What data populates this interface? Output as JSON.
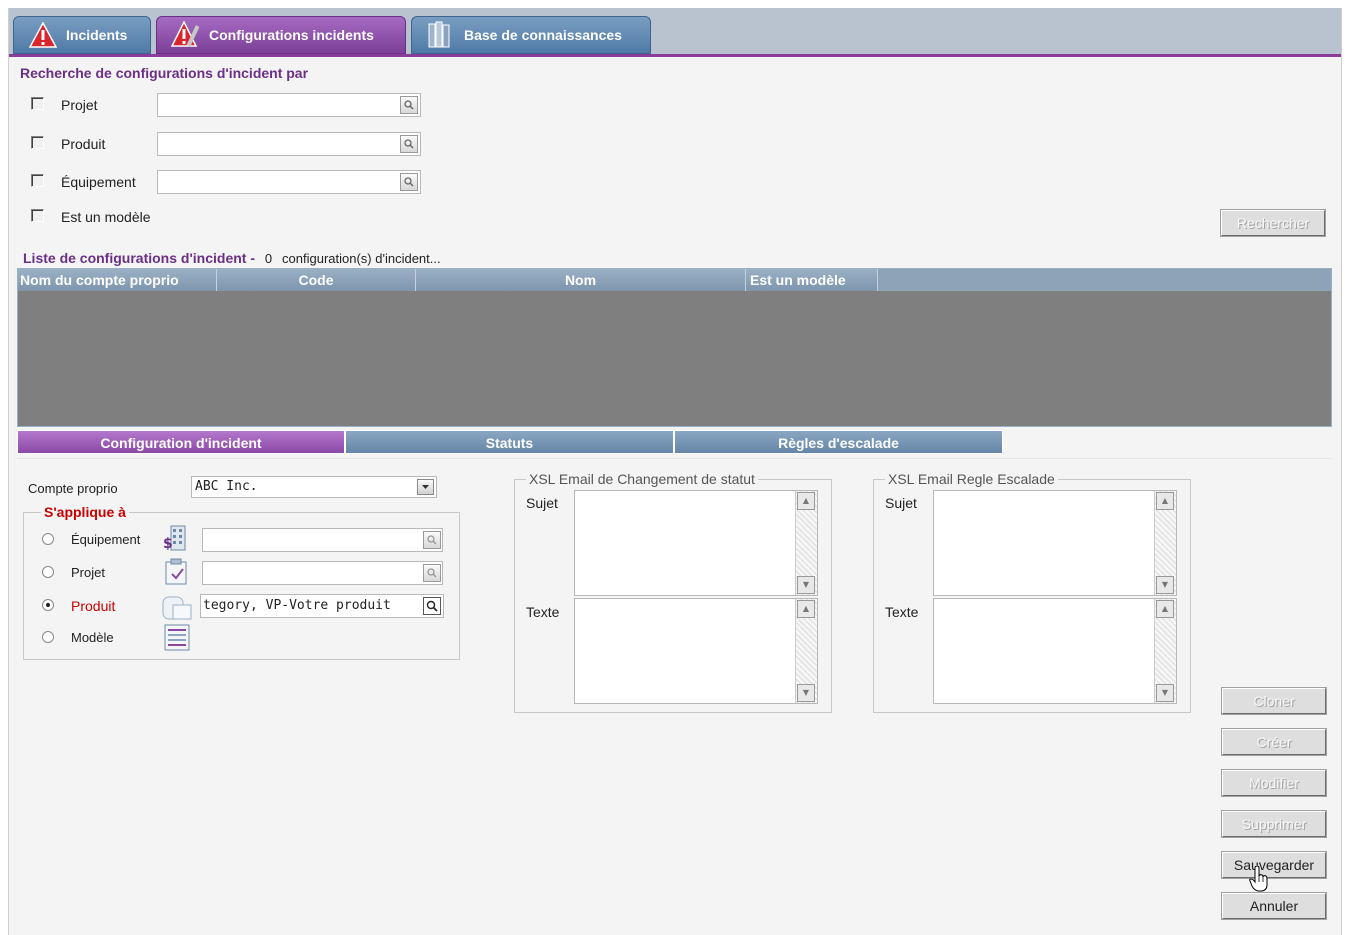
{
  "tabs": [
    {
      "label": "Incidents",
      "icon": "warning-icon"
    },
    {
      "label": "Configurations incidents",
      "icon": "warning-tools-icon"
    },
    {
      "label": "Base de connaissances",
      "icon": "books-icon"
    }
  ],
  "search": {
    "title": "Recherche de configurations d'incident par",
    "criteria": [
      {
        "label": "Projet",
        "value": ""
      },
      {
        "label": "Produit",
        "value": ""
      },
      {
        "label": "Équipement",
        "value": ""
      }
    ],
    "template_label": "Est un modèle",
    "search_button": "Rechercher"
  },
  "list": {
    "title": "Liste de configurations d'incident -",
    "count": "0",
    "count_suffix": "configuration(s) d'incident...",
    "columns": [
      "Nom du compte proprio",
      "Code",
      "Nom",
      "Est un modèle"
    ]
  },
  "subtabs": [
    "Configuration d'incident",
    "Statuts",
    "Règles d'escalade"
  ],
  "config": {
    "owner_label": "Compte proprio",
    "owner_value": "ABC Inc.",
    "applies_legend": "S'applique à",
    "applies": [
      {
        "label": "Équipement",
        "value": "",
        "selected": false,
        "icon": "equipment-icon"
      },
      {
        "label": "Projet",
        "value": "",
        "selected": false,
        "icon": "project-icon"
      },
      {
        "label": "Produit",
        "value": "tegory, VP-Votre produit",
        "selected": true,
        "icon": "product-icon"
      },
      {
        "label": "Modèle",
        "value": "",
        "selected": false,
        "icon": "template-icon"
      }
    ]
  },
  "xsl_status": {
    "legend": "XSL Email de Changement de statut",
    "subject_label": "Sujet",
    "text_label": "Texte"
  },
  "xsl_escalation": {
    "legend": "XSL Email Regle Escalade",
    "subject_label": "Sujet",
    "text_label": "Texte"
  },
  "actions": {
    "clone": "Cloner",
    "create": "Créer",
    "modify": "Modifier",
    "delete": "Supprimer",
    "save": "Sauvegarder",
    "cancel": "Annuler"
  },
  "colors": {
    "accent": "#7c3f98",
    "tab_blue": "#4f7aa6",
    "required_red": "#cc0000"
  }
}
